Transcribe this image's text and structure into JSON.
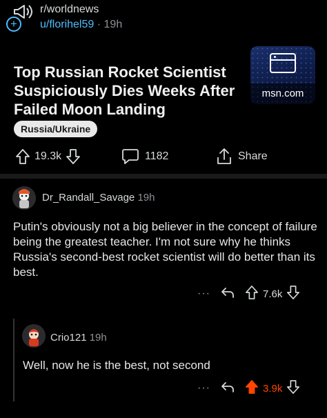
{
  "post": {
    "subreddit": "r/worldnews",
    "author": "u/florihel59",
    "separator": "·",
    "age": "19h",
    "join_symbol": "+",
    "title": "Top Russian Rocket Scientist Suspiciously Dies Weeks After Failed Moon Landing",
    "thumbnail_domain": "msn.com",
    "flair": "Russia/Ukraine",
    "votes": "19.3k",
    "comments": "1182",
    "share_label": "Share"
  },
  "comments": [
    {
      "author": "Dr_Randall_Savage",
      "age": "19h",
      "body": "Putin's obviously not a big believer in the concept of failure being the greatest teacher. I'm not sure why he thinks Russia's second-best rocket scientist will do better than its best.",
      "more": "···",
      "votes": "7.6k",
      "upvoted": false
    },
    {
      "author": "Crio121",
      "age": "19h",
      "body": "Well, now he is the best, not second",
      "more": "···",
      "votes": "3.9k",
      "upvoted": true
    }
  ],
  "colors": {
    "accent": "#4fbcff",
    "upvote": "#ff4500",
    "background": "#000000"
  }
}
